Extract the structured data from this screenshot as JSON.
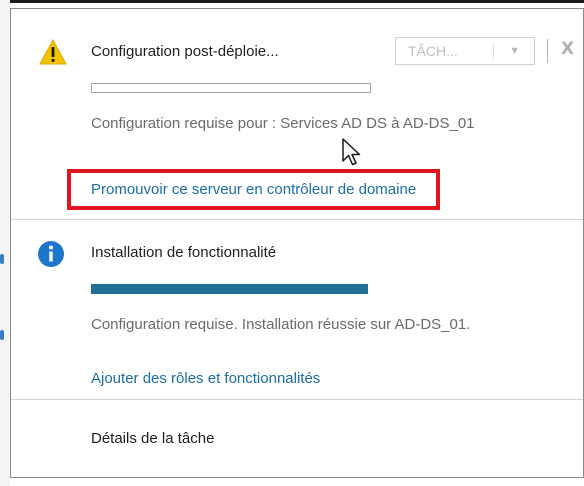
{
  "notifications": [
    {
      "title": "Configuration post-déploie...",
      "description": "Configuration requise pour : Services AD DS à AD-DS_01",
      "link": "Promouvoir ce serveur en contrôleur de domaine",
      "progress": 0
    },
    {
      "title": "Installation de fonctionnalité",
      "description": "Configuration requise. Installation réussie sur AD-DS_01.",
      "link": "Ajouter des rôles et fonctionnalités",
      "progress": 1.0
    }
  ],
  "toolbar": {
    "task_label": "TÂCH...",
    "close_glyph": "X"
  },
  "footer": {
    "task_details": "Détails de la tâche"
  },
  "colors": {
    "warning": "#f5c400",
    "info": "#1d76c9",
    "link": "#1b6ea5",
    "progress": "#1f6f97",
    "highlight": "#e0161e"
  },
  "icons": {
    "warning": "warning-triangle-icon",
    "info": "info-circle-icon",
    "dropdown": "chevron-down-icon",
    "cursor": "mouse-pointer-icon"
  }
}
